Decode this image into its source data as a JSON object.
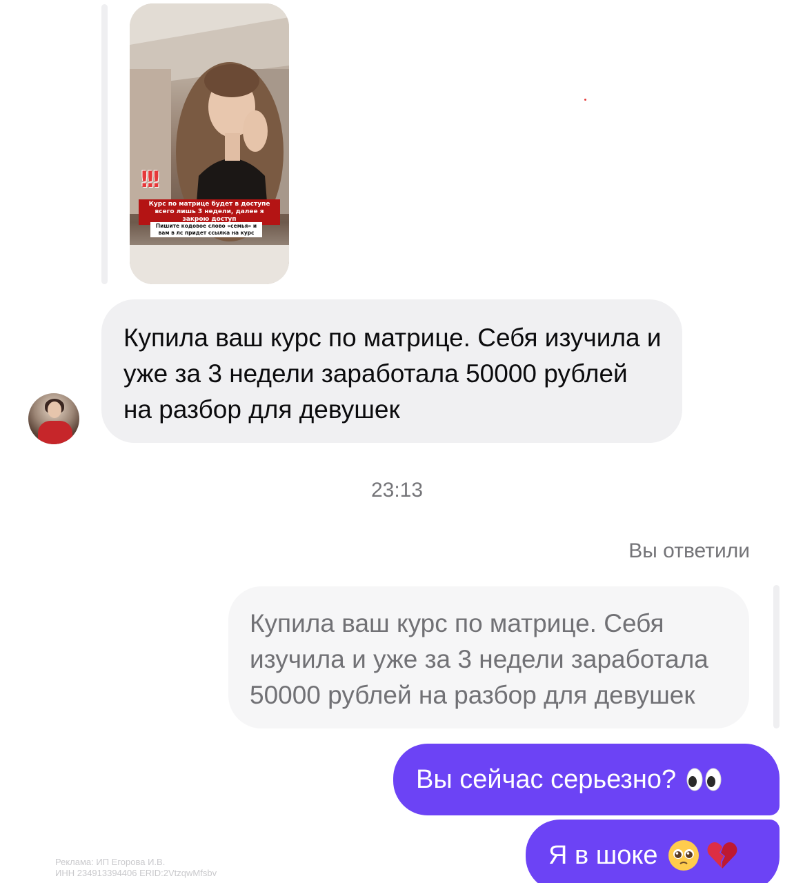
{
  "story": {
    "caption_red": "Курс по матрице будет в доступе всего лишь 3 недели, далее я закрою доступ",
    "caption_white": "Пишите кодовое слово «семья» и вам в лс придет ссылка на курс"
  },
  "messages": {
    "incoming_text": "Купила ваш курс по матрице. Себя изучила и уже за 3 недели заработала 50000 рублей на разбор для девушек",
    "timestamp": "23:13",
    "reply_label": "Вы ответили",
    "quoted_text": "Купила ваш курс по матрице. Себя изучила и уже за 3 недели заработала 50000 рублей на разбор для девушек",
    "outgoing_1": "Вы сейчас серьезно?",
    "outgoing_2": "Я в шоке"
  },
  "ad": {
    "line1": "Реклама: ИП Егорова И.В.",
    "line2": "ИНН 234913394406 ERID:2VtzqwMfsbv"
  },
  "icons": {
    "eyes": "eyes-emoji",
    "pleading": "pleading-face-emoji",
    "broken_heart": "broken-heart-emoji"
  },
  "colors": {
    "outgoing_bubble": "#6c43f5",
    "incoming_bubble": "#f0f0f2",
    "quoted_bubble": "#f6f6f7",
    "muted_text": "#747478"
  }
}
